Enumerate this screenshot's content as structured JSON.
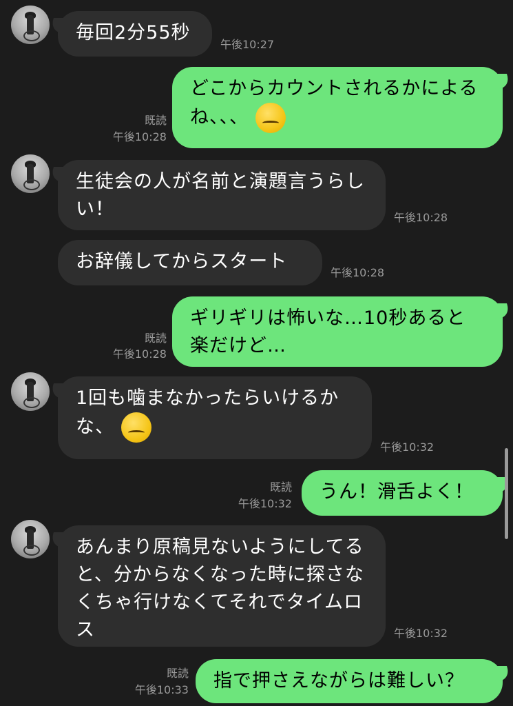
{
  "messages": [
    {
      "side": "in",
      "text": "毎回2分55秒",
      "time": "午後10:27"
    },
    {
      "side": "out",
      "text": "どこからカウントされるかによるね、、、",
      "emoji": "dizzy-face-emoji",
      "read": "既読",
      "time": "午後10:28"
    },
    {
      "side": "in",
      "text": "生徒会の人が名前と演題言うらしい！",
      "time": "午後10:28"
    },
    {
      "side": "in",
      "text": "お辞儀してからスタート",
      "time": "午後10:28"
    },
    {
      "side": "out",
      "text": "ギリギリは怖いな…10秒あると楽だけど…",
      "read": "既読",
      "time": "午後10:28"
    },
    {
      "side": "in",
      "text": "1回も噛まなかったらいけるかな、",
      "emoji": "melting-face-emoji",
      "time": "午後10:32"
    },
    {
      "side": "out",
      "text": "うん！滑舌よく！",
      "read": "既読",
      "time": "午後10:32"
    },
    {
      "side": "in",
      "text": "あんまり原稿見ないようにしてると、分からなくなった時に探さなくちゃ行けなくてそれでタイムロス",
      "time": "午後10:32"
    },
    {
      "side": "out",
      "text": "指で押さえながらは難しい？",
      "read": "既読",
      "time": "午後10:33"
    }
  ],
  "colors": {
    "background": "#1c1c1c",
    "incoming": "#2e2e2e",
    "outgoing": "#6de57c",
    "meta": "#9a9a9a"
  }
}
